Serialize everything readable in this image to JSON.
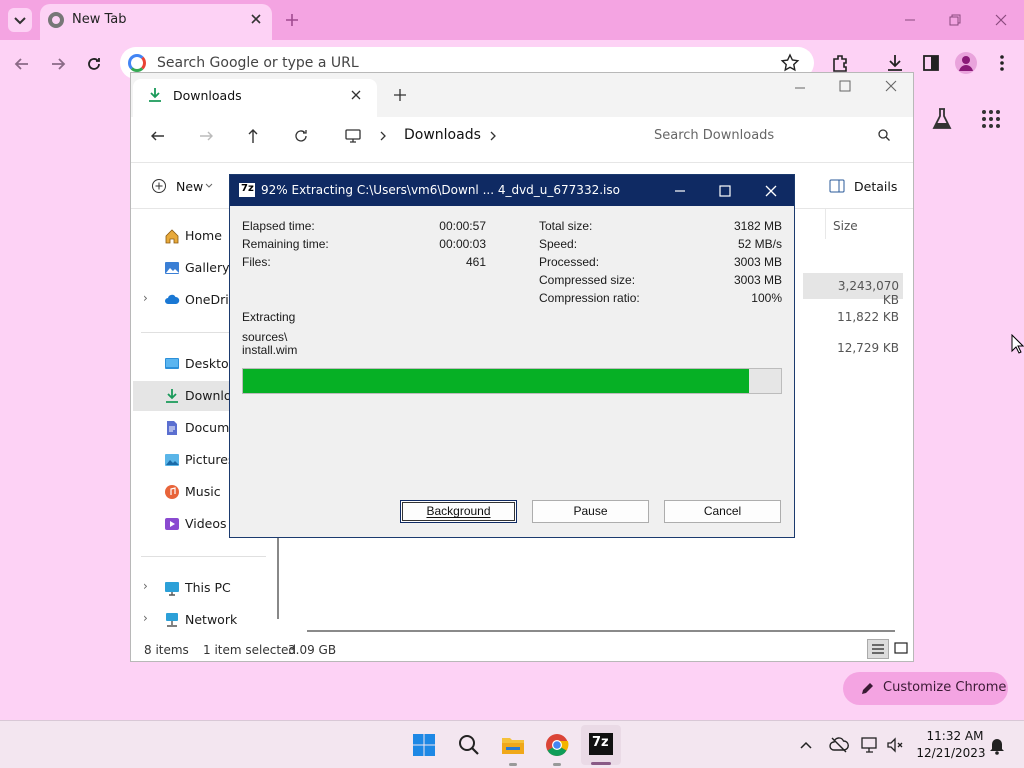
{
  "chrome": {
    "tab_title": "New Tab",
    "omnibox_placeholder": "Search Google or type a URL",
    "customize_label": "Customize Chrome"
  },
  "explorer": {
    "tab_title": "Downloads",
    "breadcrumb": "Downloads",
    "search_placeholder": "Search Downloads",
    "new_label": "New",
    "details_label": "Details",
    "size_header": "Size",
    "sidebar": [
      {
        "label": "Home",
        "icon": "home-icon"
      },
      {
        "label": "Gallery",
        "icon": "gallery-icon"
      },
      {
        "label": "OneDrive",
        "icon": "cloud-icon"
      },
      {
        "label": "Desktop",
        "icon": "desktop-icon"
      },
      {
        "label": "Downloads",
        "icon": "download-icon"
      },
      {
        "label": "Documents",
        "icon": "document-icon"
      },
      {
        "label": "Pictures",
        "icon": "picture-icon"
      },
      {
        "label": "Music",
        "icon": "music-icon"
      },
      {
        "label": "Videos",
        "icon": "video-icon"
      },
      {
        "label": "This PC",
        "icon": "pc-icon"
      },
      {
        "label": "Network",
        "icon": "network-icon"
      }
    ],
    "file_sizes": [
      "3,243,070 KB",
      "11,822 KB",
      "12,729 KB"
    ],
    "status": {
      "count": "8 items",
      "selected": "1 item selected",
      "size": "3.09 GB"
    }
  },
  "dialog": {
    "app_icon": "7z",
    "title": "92% Extracting C:\\Users\\vm6\\Downl ... 4_dvd_u_677332.iso",
    "left_stats": [
      {
        "label": "Elapsed time:",
        "value": "00:00:57"
      },
      {
        "label": "Remaining time:",
        "value": "00:00:03"
      },
      {
        "label": "Files:",
        "value": "461"
      }
    ],
    "right_stats": [
      {
        "label": "Total size:",
        "value": "3182 MB"
      },
      {
        "label": "Speed:",
        "value": "52 MB/s"
      },
      {
        "label": "Processed:",
        "value": "3003 MB"
      },
      {
        "label": "Compressed size:",
        "value": "3003 MB"
      },
      {
        "label": "Compression ratio:",
        "value": "100%"
      }
    ],
    "status_label": "Extracting",
    "current_path": "sources\\",
    "current_file": "install.wim",
    "progress": 0.94,
    "buttons": {
      "background": "Background",
      "pause": "Pause",
      "cancel": "Cancel"
    }
  },
  "taskbar": {
    "time": "11:32 AM",
    "date": "12/21/2023",
    "app_7z_label": "7z"
  },
  "colors": {
    "chrome_frame": "#f4a4e2",
    "chrome_bg": "#fdd2f5",
    "dialog_title": "#0f2a63",
    "progress": "#06b025"
  }
}
